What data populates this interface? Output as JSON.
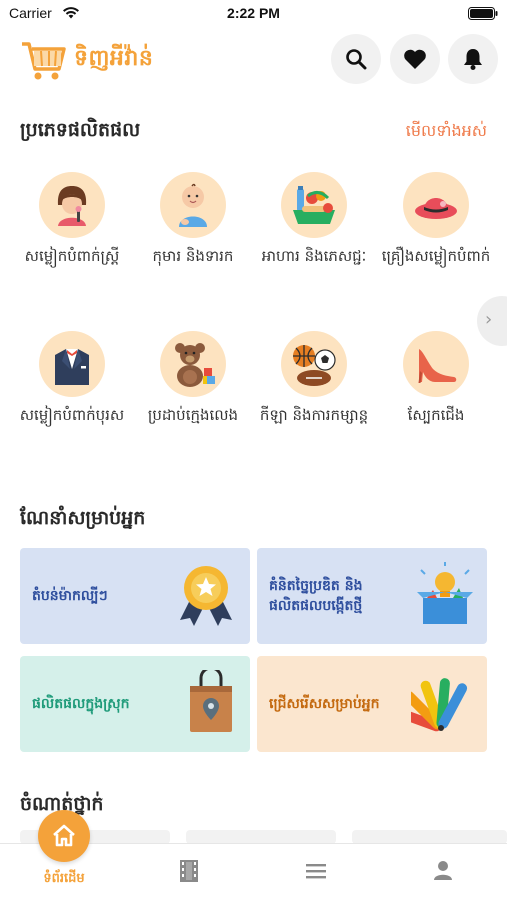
{
  "status_bar": {
    "carrier": "Carrier",
    "time": "2:22 PM"
  },
  "header": {
    "logo_text": "ទិញអីវ៉ាន់",
    "icons": [
      "search-icon",
      "heart-icon",
      "bell-icon"
    ]
  },
  "categories_section": {
    "title": "ប្រភេទផលិតផល",
    "see_all": "មើលទាំងអស់",
    "items": [
      {
        "label": "សម្លៀកបំពាក់ស្រ្តី",
        "icon": "woman-icon"
      },
      {
        "label": "កុមារ និងទារក",
        "icon": "baby-icon"
      },
      {
        "label": "អាហារ និងភេសជ្ជៈ",
        "icon": "food-icon"
      },
      {
        "label": "គ្រឿងសម្លៀកបំពាក់",
        "icon": "hat-icon"
      },
      {
        "label": "សម្លៀកបំពាក់បុរស",
        "icon": "suit-icon"
      },
      {
        "label": "ប្រដាប់ក្មេងលេង",
        "icon": "teddy-bear-icon"
      },
      {
        "label": "កីឡា និងការកម្សាន្ត",
        "icon": "sports-ball-icon"
      },
      {
        "label": "ស្បែកជើង",
        "icon": "high-heel-icon"
      }
    ]
  },
  "recommend_section": {
    "title": "ណែនាំសម្រាប់អ្នក",
    "cards": [
      {
        "label": "តំបន់ម៉ាកល្បីៗ",
        "icon": "award-medal-icon",
        "bg": "#d7e1f3",
        "color": "#2f4f9e"
      },
      {
        "label": "គំនិតច្នៃប្រឌិត និងផលិតផលបង្កើតថ្មី",
        "icon": "idea-box-icon",
        "bg": "#d7e1f3",
        "color": "#2f4f9e"
      },
      {
        "label": "ផលិតផលក្នុងស្រុក",
        "icon": "shopping-bag-icon",
        "bg": "#d5f0ea",
        "color": "#1f9b7a"
      },
      {
        "label": "ជ្រើសរើសសម្រាប់អ្នក",
        "icon": "color-palette-icon",
        "bg": "#fbe6cf",
        "color": "#c46a10"
      }
    ]
  },
  "bottom_section": {
    "title": "ចំណាត់ថ្នាក់"
  },
  "tabbar": {
    "home_label": "ទំព័រដើម",
    "tabs": [
      "home-icon",
      "film-icon",
      "menu-icon",
      "profile-icon"
    ]
  },
  "colors": {
    "accent": "#f4a23a",
    "see_all": "#ef7a4a",
    "category_bg": "#fde3c0"
  }
}
